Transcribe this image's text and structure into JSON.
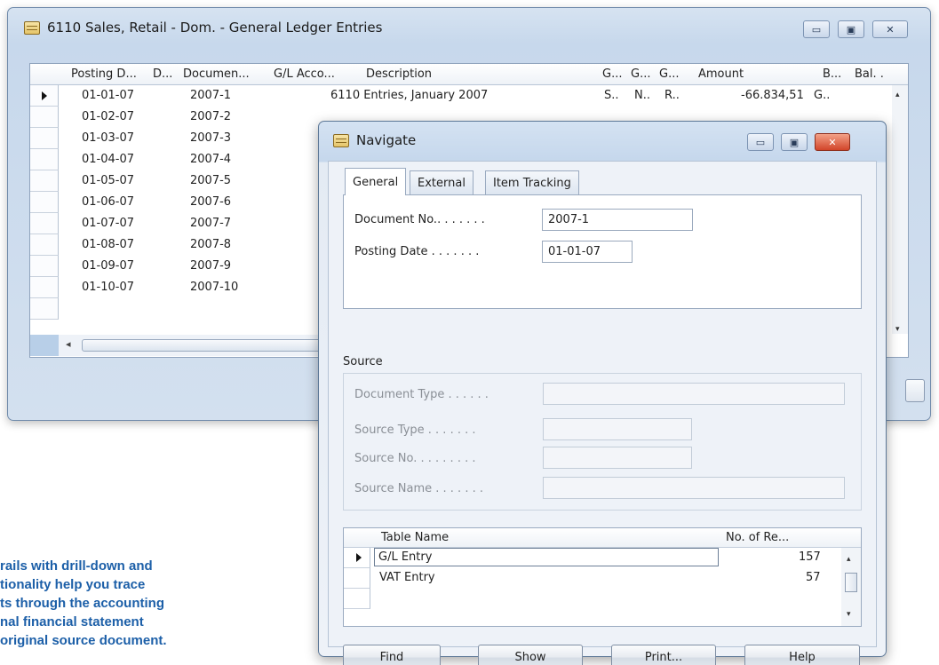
{
  "back_window": {
    "title": "6110 Sales, Retail - Dom. - General Ledger Entries",
    "controls": {
      "minimize": "▭",
      "maximize": "▣",
      "close": "✕"
    },
    "columns": [
      "Posting D...",
      "D...",
      "Documen...",
      "G/L Acco...",
      "Description",
      "G...",
      "G...",
      "G...",
      "Amount",
      "B...",
      "Bal. ."
    ],
    "rows": [
      {
        "posting_date": "01-01-07",
        "document_no": "2007-1",
        "description": "6110  Entries, January 2007",
        "g1": "S..",
        "g2": "N..",
        "g3": "R..",
        "amount": "-66.834,51",
        "b": "G.."
      },
      {
        "posting_date": "01-02-07",
        "document_no": "2007-2"
      },
      {
        "posting_date": "01-03-07",
        "document_no": "2007-3"
      },
      {
        "posting_date": "01-04-07",
        "document_no": "2007-4"
      },
      {
        "posting_date": "01-05-07",
        "document_no": "2007-5"
      },
      {
        "posting_date": "01-06-07",
        "document_no": "2007-6"
      },
      {
        "posting_date": "01-07-07",
        "document_no": "2007-7"
      },
      {
        "posting_date": "01-08-07",
        "document_no": "2007-8"
      },
      {
        "posting_date": "01-09-07",
        "document_no": "2007-9"
      },
      {
        "posting_date": "01-10-07",
        "document_no": "2007-10"
      }
    ]
  },
  "caption": {
    "lines": [
      "rails with drill-down and",
      "tionality help you trace",
      "ts through the accounting",
      "nal financial statement",
      "original source document."
    ],
    "color": "#1c5fa8"
  },
  "navigate": {
    "title": "Navigate",
    "tabs": [
      "General",
      "External",
      "Item Tracking"
    ],
    "document_no_label": "Document No.. . . . . . .",
    "document_no_value": "2007-1",
    "posting_date_label": "Posting Date . . . . . . .",
    "posting_date_value": "01-01-07",
    "source_label": "Source",
    "document_type_label": "Document Type . . . . . .",
    "source_type_label": "Source Type  . . . . . . .",
    "source_no_label": "Source No. . . . . . . . .",
    "source_name_label": "Source Name . . . . . . .",
    "table": {
      "headers": [
        "Table Name",
        "No. of Re..."
      ],
      "rows": [
        {
          "name": "G/L Entry",
          "count": "157"
        },
        {
          "name": "VAT Entry",
          "count": "57"
        }
      ]
    },
    "buttons": {
      "find": "Find",
      "show": "Show",
      "print": "Print...",
      "help": "Help"
    }
  }
}
